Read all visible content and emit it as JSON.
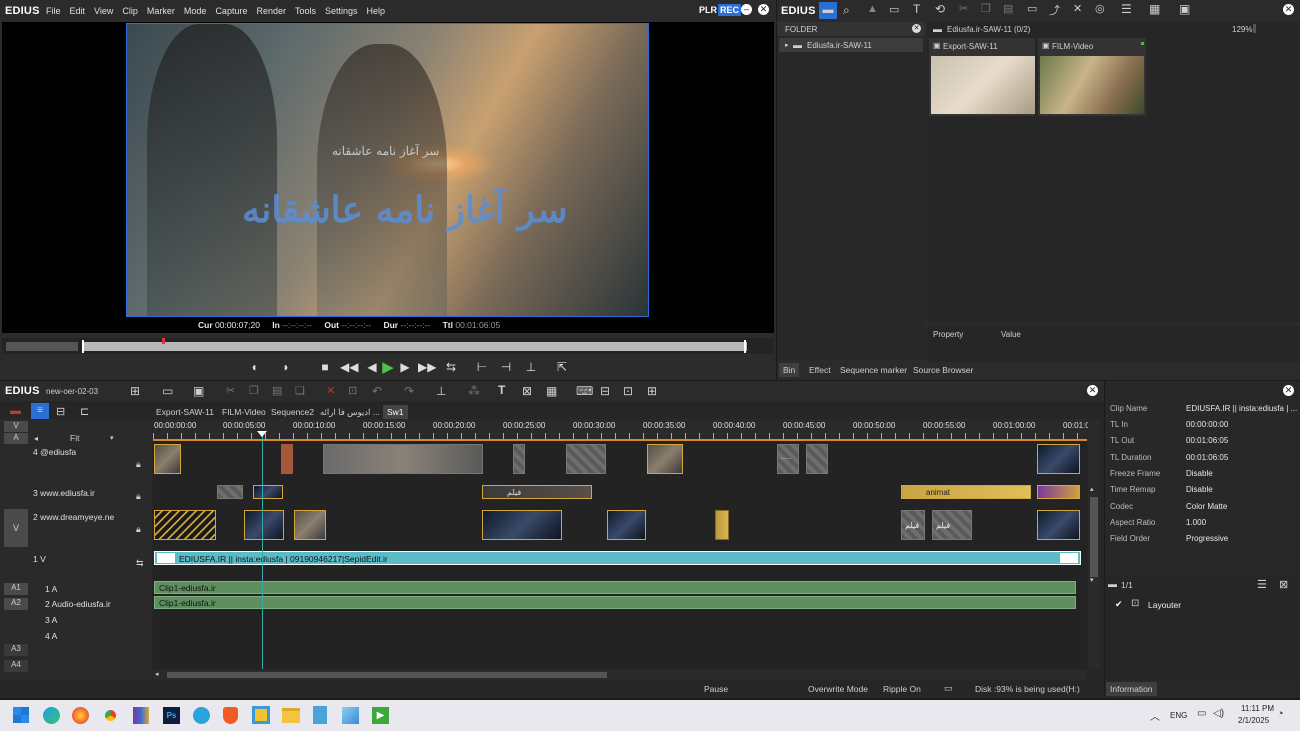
{
  "app": {
    "logo": "EDIUS",
    "menu": [
      "File",
      "Edit",
      "View",
      "Clip",
      "Marker",
      "Mode",
      "Capture",
      "Render",
      "Tools",
      "Settings",
      "Help"
    ],
    "plr": "PLR",
    "rec": "REC"
  },
  "preview": {
    "overlay_text": "سر آغاز نامه عاشقانه",
    "overlay_small": "سر آغاز نامه عاشقانه",
    "cur_label": "Cur",
    "cur": "00:00:07;20",
    "in_label": "In",
    "in": "--:--:--:--",
    "out_label": "Out",
    "out": "--:--:--:--",
    "dur_label": "Dur",
    "dur": "--:--:--:--",
    "ttl_label": "Ttl",
    "ttl": "00:01:06:05"
  },
  "bin": {
    "logo": "EDIUS",
    "zoom": "129%",
    "folder_header": "FOLDER",
    "folder_item": "Ediusfa.ir-SAW-11",
    "path": "Ediusfa.ir-SAW-11 (0/2)",
    "clips": [
      {
        "name": "Export-SAW-11"
      },
      {
        "name": "FILM-Video"
      }
    ],
    "prop_col": "Property",
    "value_col": "Value",
    "tabs": [
      "Bin",
      "Effect",
      "Sequence marker",
      "Source Browser"
    ]
  },
  "timeline": {
    "logo": "EDIUS",
    "project": "new-oer-02-03",
    "fit": "Fit",
    "seq_tabs": [
      "Export-SAW-11",
      "FILM-Video",
      "Sequence2",
      "ادیوس فا ارائه ...",
      "Sw1"
    ],
    "ruler": [
      "00:00:00:00",
      "00:00:05:00",
      "00:00:10:00",
      "00:00:15:00",
      "00:00:20:00",
      "00:00:25:00",
      "00:00:30:00",
      "00:00:35:00",
      "00:00:40:00",
      "00:00:45:00",
      "00:00:50:00",
      "00:00:55:00",
      "00:01:00:00",
      "00:01:0"
    ],
    "tracks": {
      "t4": "4 @ediusfa",
      "t3": "3 www.ediusfa.ir",
      "t2": "2 www.dreamyeye.ne",
      "t1": "1 V",
      "a1": "1 A",
      "a2": "2 Audio-ediusfa.ir",
      "a3": "3 A",
      "a4": "4 A"
    },
    "side_labels": {
      "v": "V",
      "a": "A",
      "v2": "V",
      "a1": "A1",
      "a2": "A2",
      "a3": "A3",
      "a4": "A4"
    },
    "v1_clip": "EDIUSFA.IR || insta:ediusfa | 09190946217|SepidEdit.ir",
    "a1_clip": "Clip1-ediusfa.ir",
    "a2_clip": "Clip1-ediusfa.ir",
    "clip_text_film1": "فیلم",
    "clip_text_film2": "فیلم",
    "clip_text_film3": "فیلم",
    "clip_text_film4": "فیلم",
    "clip_text_animat": "animat",
    "clip_text_dots": "......"
  },
  "status": {
    "mode": "Pause",
    "overwrite": "Overwrite Mode",
    "ripple": "Ripple On",
    "disk": "Disk :93% is being used(H:)"
  },
  "info": {
    "rows": [
      {
        "k": "Clip Name",
        "v": "EDIUSFA.IR || insta:ediusfa | ..."
      },
      {
        "k": "TL In",
        "v": "00:00:00:00"
      },
      {
        "k": "TL Out",
        "v": "00:01:06:05"
      },
      {
        "k": "TL Duration",
        "v": "00:01:06:05"
      },
      {
        "k": "Freeze Frame",
        "v": "Disable"
      },
      {
        "k": "Time Remap",
        "v": "Disable"
      },
      {
        "k": "Codec",
        "v": "Color Matte"
      },
      {
        "k": "Aspect Ratio",
        "v": "1.000"
      },
      {
        "k": "Field Order",
        "v": "Progressive"
      }
    ],
    "count": "1/1",
    "filter": "Layouter",
    "tab": "Information"
  },
  "taskbar": {
    "lang": "ENG",
    "time": "11:11 PM",
    "date": "2/1/2025"
  },
  "colors": {
    "accent": "#2a6fd6",
    "v1clip": "#5bbcc8",
    "audio": "#5e8f5e",
    "clipborder": "#d2a63a"
  }
}
